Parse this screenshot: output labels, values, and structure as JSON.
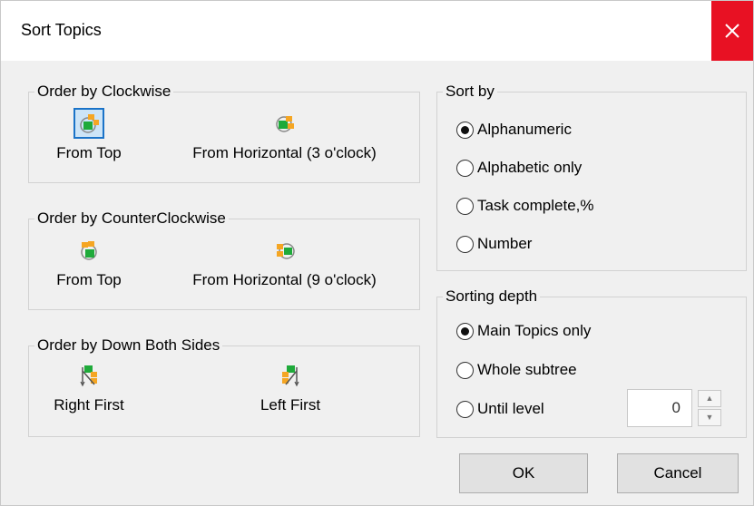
{
  "window": {
    "title": "Sort Topics",
    "close_icon": "close-icon"
  },
  "clockwise": {
    "legend": "Order by Clockwise",
    "from_top": "From Top",
    "from_horizontal": "From Horizontal (3 o'clock)"
  },
  "counterclockwise": {
    "legend": "Order by CounterClockwise",
    "from_top": "From Top",
    "from_horizontal": "From Horizontal (9 o'clock)"
  },
  "down_both": {
    "legend": "Order by Down Both Sides",
    "right_first": "Right First",
    "left_first": "Left First"
  },
  "sort_by": {
    "legend": "Sort by",
    "options": [
      "Alphanumeric",
      "Alphabetic only",
      "Task complete,%",
      "Number"
    ],
    "selected": "Alphanumeric"
  },
  "sorting_depth": {
    "legend": "Sorting depth",
    "options": [
      "Main Topics only",
      "Whole subtree",
      "Until level"
    ],
    "selected": "Main Topics only",
    "level_value": "0"
  },
  "buttons": {
    "ok": "OK",
    "cancel": "Cancel"
  },
  "colors": {
    "close_bg": "#e81123",
    "selection": "#1a73c8",
    "green": "#1faa3a",
    "orange": "#f5a623"
  }
}
